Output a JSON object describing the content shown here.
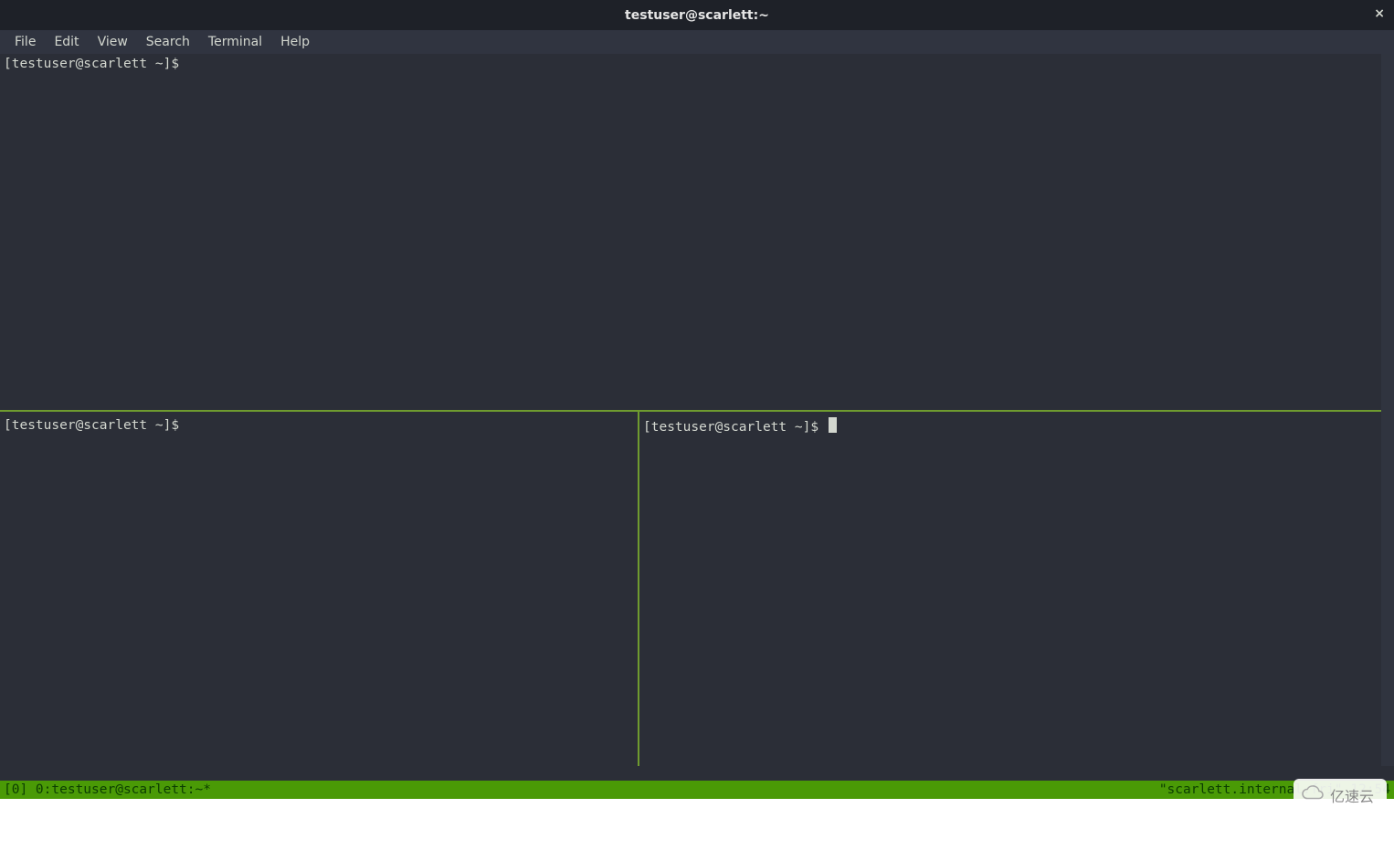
{
  "titlebar": {
    "title": "testuser@scarlett:~",
    "close_icon": "×"
  },
  "menubar": {
    "items": [
      "File",
      "Edit",
      "View",
      "Search",
      "Terminal",
      "Help"
    ]
  },
  "panes": {
    "top": {
      "prompt": "[testuser@scarlett ~]$ "
    },
    "bottom_left": {
      "prompt": "[testuser@scarlett ~]$ "
    },
    "bottom_right": {
      "prompt": "[testuser@scarlett ~]$ ",
      "has_cursor": true
    }
  },
  "statusbar": {
    "left": "[0] 0:testuser@scarlett:~*",
    "right": "\"scarlett.internal.fri\" 12:54"
  },
  "watermark": {
    "text": "亿速云"
  }
}
